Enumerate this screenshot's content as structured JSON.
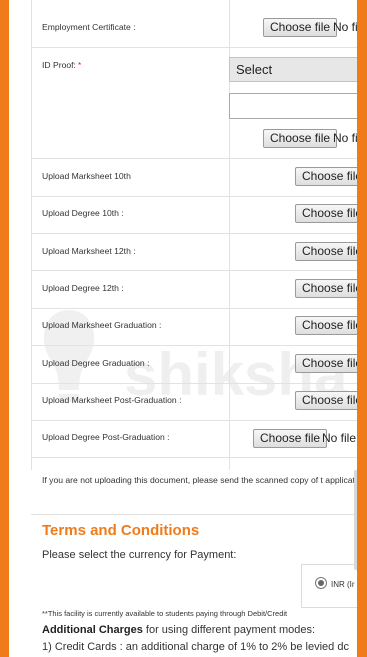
{
  "rows": [
    {
      "label": "Employment Certificate :",
      "button": "Choose file",
      "status": "No fi"
    },
    {
      "label": "ID Proof:",
      "required": "*",
      "select_value": "Select",
      "button": "Choose file",
      "status": "No fi"
    },
    {
      "label": "Upload Marksheet 10th",
      "button": "Choose file"
    },
    {
      "label": "Upload Degree 10th :",
      "button": "Choose file"
    },
    {
      "label": "Upload Marksheet 12th :",
      "button": "Choose file"
    },
    {
      "label": "Upload Degree 12th :",
      "button": "Choose file"
    },
    {
      "label": "Upload Marksheet Graduation :",
      "button": "Choose file"
    },
    {
      "label": "Upload Degree Graduation :",
      "button": "Choose file"
    },
    {
      "label": "Upload Marksheet Post-Graduation :",
      "button": "Choose file"
    },
    {
      "label": "Upload Degree Post-Graduation :",
      "button": "Choose file",
      "status": "No file"
    }
  ],
  "note": "If you are not uploading this document, please send the scanned copy of t application",
  "terms": {
    "title": "Terms and Conditions",
    "currency_prompt": "Please select the currency for Payment:",
    "currency_option": "INR (Ir",
    "facility_note": "**This facility is currently available to students paying through Debit/Credit",
    "additional_title": "Additional Charges",
    "additional_rest": " for using different payment modes:",
    "credit_line": "1) Credit Cards : an additional charge of 1% to 2% be levied dc"
  },
  "watermark": "shiksha",
  "colors": {
    "accent": "#f07b1a",
    "required": "#e02424"
  }
}
